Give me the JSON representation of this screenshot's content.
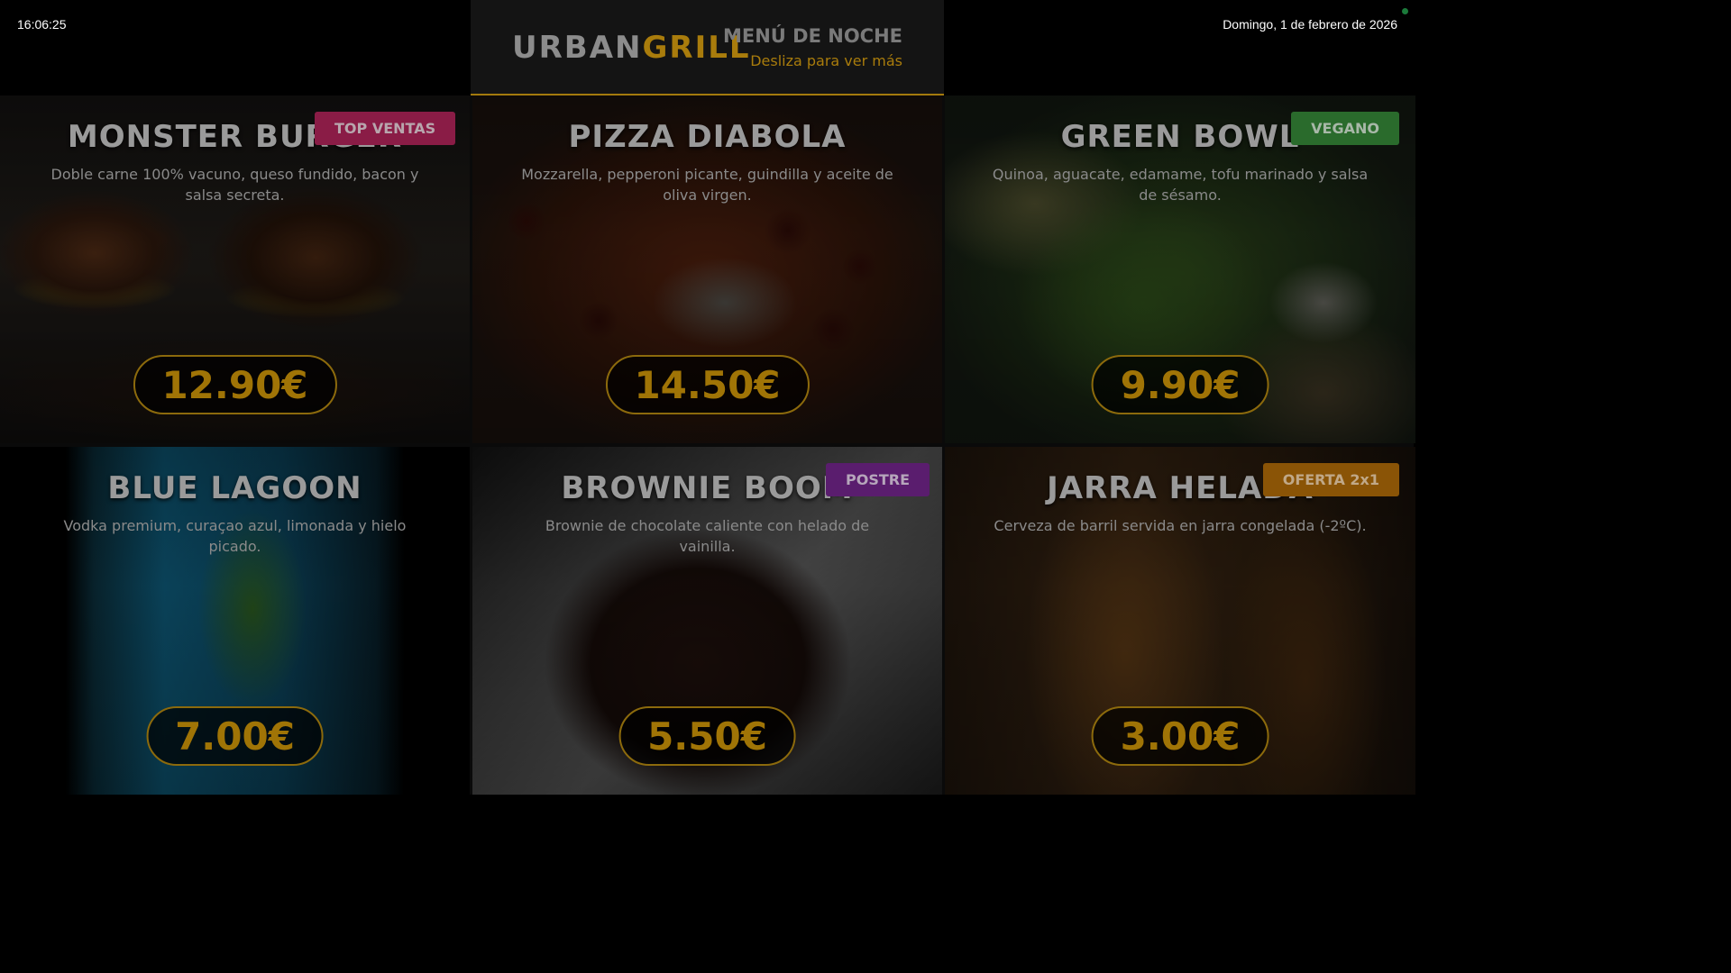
{
  "topbar": {
    "time": "16:06:25",
    "date": "Domingo, 1 de febrero de 2026"
  },
  "header": {
    "brand_part1": "URBAN",
    "brand_part2": "GRILL",
    "menu_title": "MENÚ DE NOCHE",
    "menu_subtitle": "Desliza para ver más"
  },
  "colors": {
    "accent_gold": "#a97c0c",
    "badge_top_ventas": "#8a1c46",
    "badge_vegano": "#2a6b2c",
    "badge_postre": "#5a1d6e",
    "badge_oferta": "#8a5406",
    "status_dot": "#1b7a3a"
  },
  "items": [
    {
      "name": "MONSTER BURGER",
      "description": "Doble carne 100% vacuno, queso fundido, bacon y salsa secreta.",
      "price": "12.90€",
      "badge": "TOP VENTAS"
    },
    {
      "name": "PIZZA DIABOLA",
      "description": "Mozzarella, pepperoni picante, guindilla y aceite de oliva virgen.",
      "price": "14.50€",
      "badge": ""
    },
    {
      "name": "GREEN BOWL",
      "description": "Quinoa, aguacate, edamame, tofu marinado y salsa de sésamo.",
      "price": "9.90€",
      "badge": "VEGANO"
    },
    {
      "name": "BLUE LAGOON",
      "description": "Vodka premium, curaçao azul, limonada y hielo picado.",
      "price": "7.00€",
      "badge": ""
    },
    {
      "name": "BROWNIE BOOM",
      "description": "Brownie de chocolate caliente con helado de vainilla.",
      "price": "5.50€",
      "badge": "POSTRE"
    },
    {
      "name": "JARRA HELADA",
      "description": "Cerveza de barril servida en jarra congelada (-2ºC).",
      "price": "3.00€",
      "badge": "OFERTA 2x1"
    }
  ]
}
